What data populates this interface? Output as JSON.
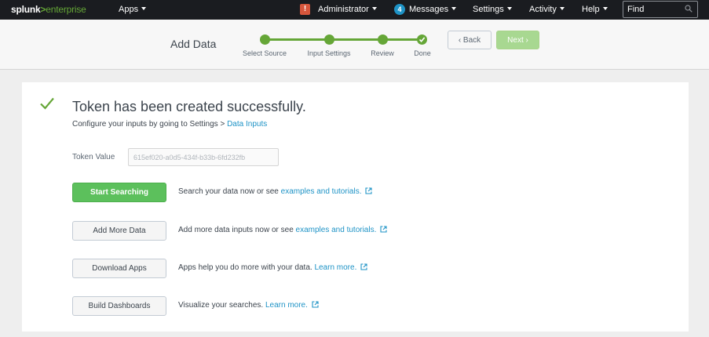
{
  "topbar": {
    "logo_main": "splunk",
    "logo_gt": ">",
    "logo_product": "enterprise",
    "apps": "Apps",
    "alert_symbol": "!",
    "user": "Administrator",
    "messages_count": "4",
    "messages": "Messages",
    "settings": "Settings",
    "activity": "Activity",
    "help": "Help",
    "find_placeholder": "Find"
  },
  "wizard": {
    "title": "Add Data",
    "steps": [
      "Select Source",
      "Input Settings",
      "Review",
      "Done"
    ],
    "back_label": "‹ Back",
    "next_label": "Next ›"
  },
  "main": {
    "title": "Token has been created successfully.",
    "subtitle_prefix": "Configure your inputs by going to Settings > ",
    "subtitle_link": "Data Inputs",
    "token_label": "Token Value",
    "token_value": "615ef020-a0d5-434f-b33b-6fd232fb",
    "actions": [
      {
        "label": "Start Searching",
        "text": "Search your data now or see ",
        "link": "examples and tutorials."
      },
      {
        "label": "Add More Data",
        "text": "Add more data inputs now or see ",
        "link": "examples and tutorials."
      },
      {
        "label": "Download Apps",
        "text": "Apps help you do more with your data. ",
        "link": "Learn more."
      },
      {
        "label": "Build Dashboards",
        "text": "Visualize your searches. ",
        "link": "Learn more."
      }
    ]
  },
  "colors": {
    "accent_green": "#65a637",
    "primary_button": "#5cc05c",
    "link_blue": "#1e93c6",
    "alert_red": "#d6563c"
  }
}
